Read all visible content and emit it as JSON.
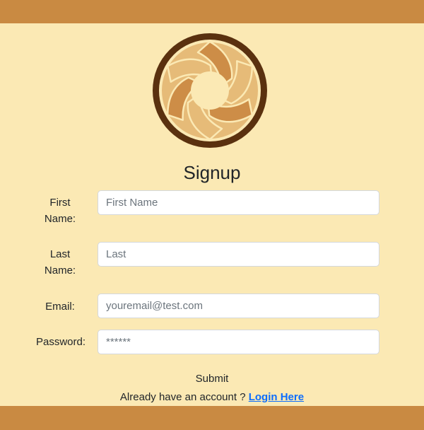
{
  "colors": {
    "background": "#fbe9b4",
    "bars": "#c98a42",
    "link": "#0d6efd",
    "logo_ring": "#5a310f",
    "logo_blade_light": "#e6bb78",
    "logo_blade_dark": "#cd8d47"
  },
  "logo": {
    "icon": "aperture-logo-icon"
  },
  "form": {
    "title": "Signup",
    "first_name": {
      "label": "First Name:",
      "placeholder": "First Name",
      "value": ""
    },
    "last_name": {
      "label": "Last Name:",
      "placeholder": "Last",
      "value": ""
    },
    "email": {
      "label": "Email:",
      "placeholder": "youremail@test.com",
      "value": ""
    },
    "password": {
      "label": "Password:",
      "placeholder": "******",
      "value": ""
    },
    "submit_label": "Submit"
  },
  "footer": {
    "prompt": "Already have an account ? ",
    "login_link": "Login Here"
  }
}
